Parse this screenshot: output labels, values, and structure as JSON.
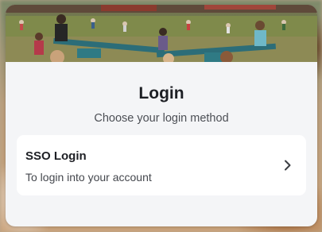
{
  "login": {
    "title": "Login",
    "subtitle": "Choose your login method",
    "options": [
      {
        "title": "SSO Login",
        "description": "To login into your account",
        "icon": "chevron-right-icon"
      }
    ]
  },
  "colors": {
    "card_bg": "#f4f5f7",
    "option_bg": "#ffffff",
    "text_primary": "#1d1f24",
    "text_secondary": "#4c4f55",
    "seesaw_teal": "#2c6d78"
  }
}
